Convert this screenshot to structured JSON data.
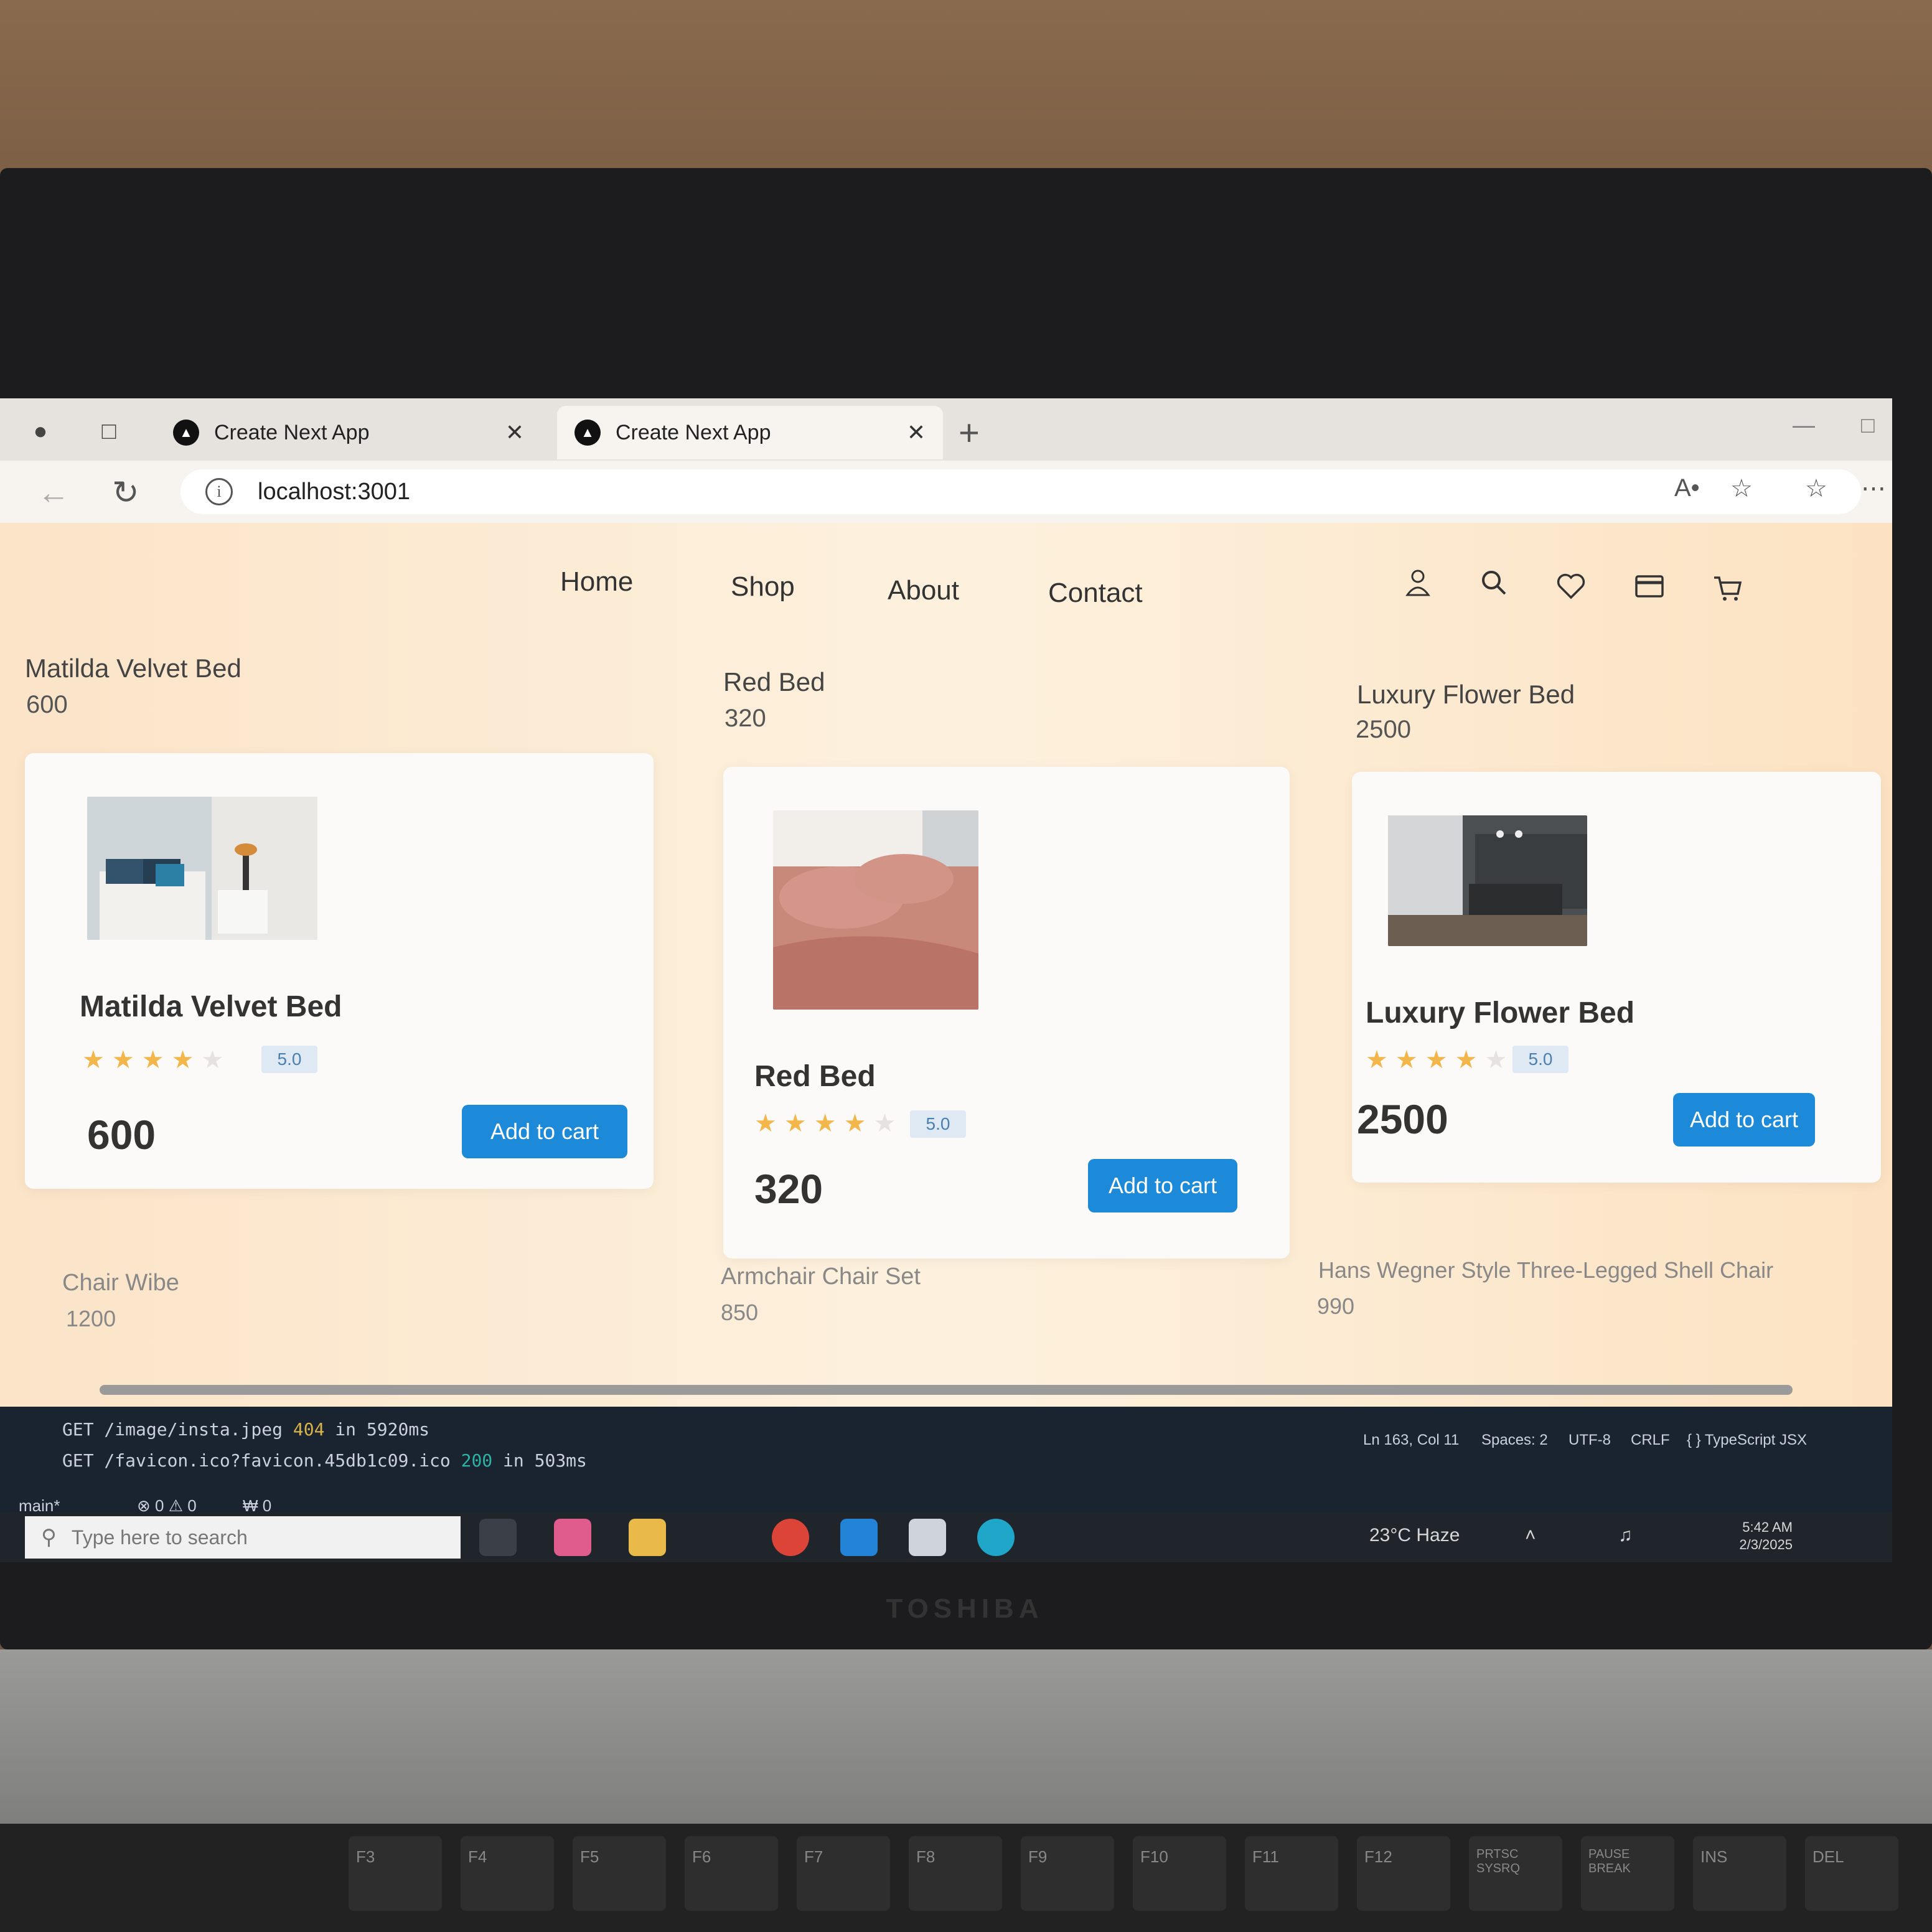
{
  "browser": {
    "tabs": [
      {
        "title": "Create Next App",
        "active": false
      },
      {
        "title": "Create Next App",
        "active": true
      }
    ],
    "url": "localhost:3001"
  },
  "nav": {
    "links": [
      "Home",
      "Shop",
      "About",
      "Contact"
    ],
    "actions": [
      "user-icon",
      "search-icon",
      "heart-icon",
      "card-icon",
      "cart-icon"
    ]
  },
  "products": [
    {
      "title": "Matilda Velvet Bed",
      "price": "600",
      "name": "Matilda Velvet Bed",
      "stars": 4,
      "rating": "5.0",
      "card_price": "600",
      "button": "Add to cart"
    },
    {
      "title": "Red Bed",
      "price": "320",
      "name": "Red Bed",
      "stars": 4,
      "rating": "5.0",
      "card_price": "320",
      "button": "Add to cart"
    },
    {
      "title": "Luxury Flower Bed",
      "price": "2500",
      "name": "Luxury Flower Bed",
      "stars": 4,
      "rating": "5.0",
      "card_price": "2500",
      "button": "Add to cart"
    }
  ],
  "next_row": [
    {
      "title": "Chair Wibe",
      "price": "1200"
    },
    {
      "title": "Armchair Chair Set",
      "price": "850"
    },
    {
      "title": "Hans Wegner Style Three-Legged Shell Chair",
      "price": "990"
    }
  ],
  "terminal": {
    "line1_prefix": "GET /image/insta.jpeg ",
    "line1_status": "404",
    "line1_suffix": " in 5920ms",
    "line2_prefix": "GET /favicon.ico?favicon.45db1c09.ico ",
    "line2_status": "200",
    "line2_suffix": " in 503ms"
  },
  "editor_status": {
    "position": "Ln 163, Col 11",
    "spaces": "Spaces: 2",
    "encoding": "UTF-8",
    "eol": "CRLF",
    "language": "{ } TypeScript JSX",
    "branch": "main*",
    "problems": "⊗ 0 ⚠ 0",
    "ports": "₩ 0"
  },
  "taskbar": {
    "search_placeholder": "Type here to search",
    "weather": "23°C  Haze",
    "time": "5:42 AM",
    "date": "2/3/2025"
  },
  "laptop_brand": "TOSHIBA",
  "keyboard_keys": [
    "F3",
    "F4",
    "F5",
    "F6",
    "F7",
    "F8",
    "F9",
    "F10",
    "F11",
    "F12",
    "PRTSC SYSRQ",
    "PAUSE BREAK",
    "INS",
    "DEL"
  ],
  "colors": {
    "accent": "#1d8ad9",
    "star": "#f2b64a",
    "page_bg": "#fdf1de"
  }
}
